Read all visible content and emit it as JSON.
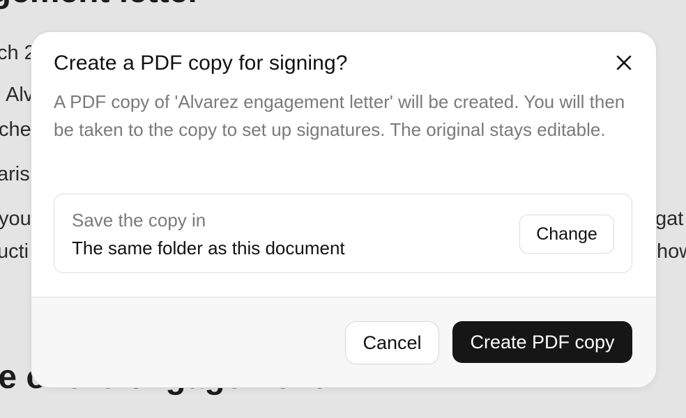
{
  "background_document": {
    "title_fragment": "agement letter",
    "text_fragments": {
      "line_date": "ch 2",
      "line_alv": "Alv",
      "line_che": "che",
      "line_aris": "aris",
      "line_you": "you",
      "line_ucti": "ucti",
      "line_gat": "gat",
      "line_how": "how"
    },
    "heading2_fragment": "pe of the engagement"
  },
  "dialog": {
    "title": "Create a PDF copy for signing?",
    "close_icon": "close-icon",
    "description": "A PDF copy of 'Alvarez engagement letter' will be created. You will then be taken to the copy to set up signatures. The original stays editable.",
    "save_location": {
      "label": "Save the copy in",
      "value": "The same folder as this document",
      "change_label": "Change"
    },
    "footer": {
      "cancel_label": "Cancel",
      "primary_label": "Create PDF copy"
    }
  },
  "colors": {
    "backdrop": "#e4e4e4",
    "dialog_bg": "#ffffff",
    "footer_bg": "#f7f7f7",
    "muted_text": "#7a7a7a",
    "primary_button": "#161616"
  }
}
